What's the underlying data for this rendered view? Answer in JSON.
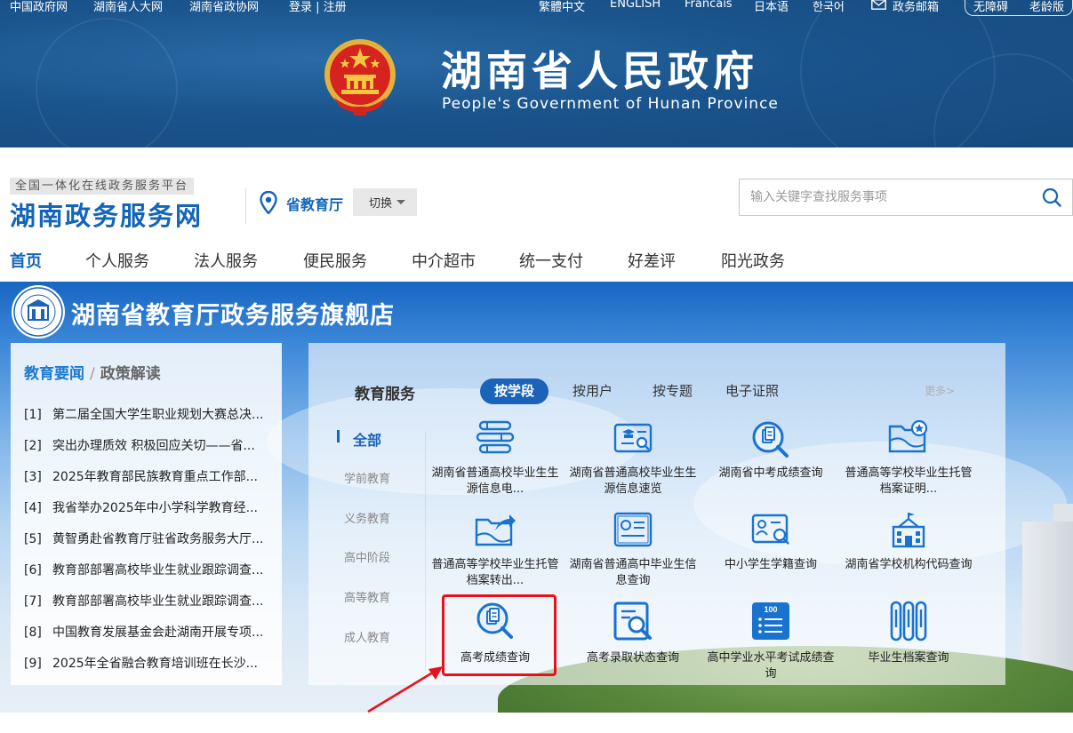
{
  "topbar": {
    "links": [
      "中国政府网",
      "湖南省人大网",
      "湖南省政协网",
      "登录 | 注册"
    ],
    "languages": [
      "繁體中文",
      "ENGLISH",
      "Francais",
      "日本语",
      "한국어"
    ],
    "mail_label": "政务邮箱",
    "accessibility": [
      "无障碍",
      "老龄版"
    ]
  },
  "banner": {
    "title": "湖南省人民政府",
    "subtitle": "People's Government of Hunan Province"
  },
  "header": {
    "platform_tag": "全国一体化在线政务服务平台",
    "site_title": "湖南政务服务网",
    "dept_name": "省教育厅",
    "switch_label": "切换",
    "search_placeholder": "输入关键字查找服务事项"
  },
  "nav": {
    "items": [
      "首页",
      "个人服务",
      "法人服务",
      "便民服务",
      "中介超市",
      "统一支付",
      "好差评",
      "阳光政务"
    ],
    "active": "首页"
  },
  "store": {
    "title": "湖南省教育厅政务服务旗舰店"
  },
  "news": {
    "tab_active": "教育要闻",
    "separator": "/",
    "tab_other": "政策解读",
    "items": [
      {
        "num": "[1]",
        "text": "第二届全国大学生职业规划大赛总决..."
      },
      {
        "num": "[2]",
        "text": "突出办理质效 积极回应关切——省..."
      },
      {
        "num": "[3]",
        "text": "2025年教育部民族教育重点工作部..."
      },
      {
        "num": "[4]",
        "text": "我省举办2025年中小学科学教育经..."
      },
      {
        "num": "[5]",
        "text": "黄智勇赴省教育厅驻省政务服务大厅..."
      },
      {
        "num": "[6]",
        "text": "教育部部署高校毕业生就业跟踪调查..."
      },
      {
        "num": "[7]",
        "text": "教育部部署高校毕业生就业跟踪调查..."
      },
      {
        "num": "[8]",
        "text": "中国教育发展基金会赴湖南开展专项..."
      },
      {
        "num": "[9]",
        "text": "2025年全省融合教育培训班在长沙..."
      }
    ]
  },
  "services": {
    "title": "教育服务",
    "tabs": [
      "按学段",
      "按用户",
      "按专题",
      "电子证照"
    ],
    "more": "更多>",
    "categories": [
      "全部",
      "学前教育",
      "义务教育",
      "高中阶段",
      "高等教育",
      "成人教育"
    ],
    "items": [
      {
        "label": "湖南省普通高校毕业生生源信息电...",
        "icon": "books-icon"
      },
      {
        "label": "湖南省普通高校毕业生生源信息速览",
        "icon": "id-card-search-icon"
      },
      {
        "label": "湖南省中考成绩查询",
        "icon": "doc-search-icon"
      },
      {
        "label": "普通高等学校毕业生托管档案证明...",
        "icon": "folder-star-icon"
      },
      {
        "label": "普通高等学校毕业生托管档案转出...",
        "icon": "folder-share-icon"
      },
      {
        "label": "湖南省普通高中毕业生信息查询",
        "icon": "certificate-icon"
      },
      {
        "label": "中小学生学籍查询",
        "icon": "student-card-search-icon"
      },
      {
        "label": "湖南省学校机构代码查询",
        "icon": "school-icon"
      },
      {
        "label": "高考成绩查询",
        "icon": "doc-search-icon"
      },
      {
        "label": "高考录取状态查询",
        "icon": "doc-magnifier-icon"
      },
      {
        "label": "高中学业水平考试成绩查询",
        "icon": "score-list-icon",
        "badge": "100"
      },
      {
        "label": "毕业生档案查询",
        "icon": "archive-icon"
      }
    ]
  },
  "colors": {
    "primary": "#1365b8",
    "accent": "#1a63b8",
    "highlight": "#e8111b"
  }
}
